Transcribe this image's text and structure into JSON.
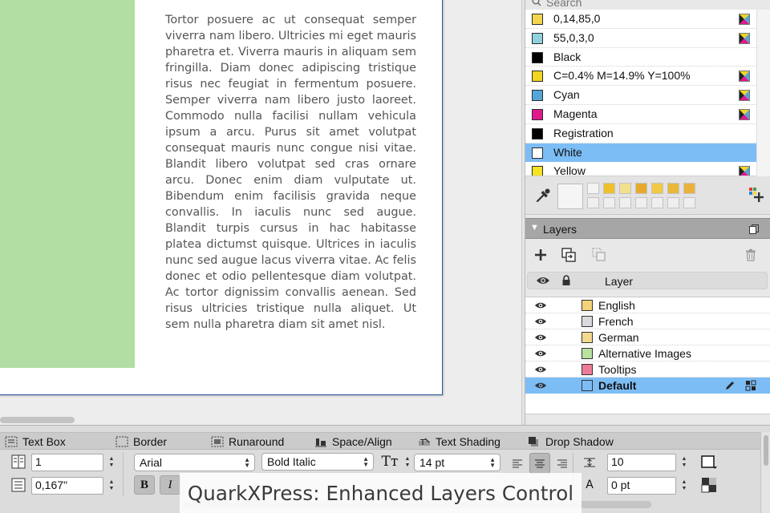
{
  "canvas": {
    "body_text": "Tortor posuere ac ut consequat semper viverra nam libero. Ultricies mi eget mauris pharetra et. Viverra mauris in aliquam sem fringilla. Diam donec adipiscing tristique risus nec feugiat in fermentum posuere. Semper viverra nam libero justo laoreet. Commodo nulla facilisi nullam vehicula ipsum a arcu. Purus sit amet volutpat consequat mauris nunc congue nisi vitae. Blandit libero volutpat sed cras ornare arcu. Donec enim diam vulputate ut. Bibendum enim facilisis gravida neque convallis. In iaculis nunc sed augue. Blandit turpis cursus in hac habitasse platea dictumst quisque. Ultrices in iaculis nunc sed augue lacus viverra vitae. Ac felis donec et odio pellentesque diam volutpat. Ac tortor dignissim convallis aenean. Sed risus ultricies tristique nulla aliquet. Ut sem nulla pharetra diam sit amet nisl."
  },
  "colors_panel": {
    "search_placeholder": "Search",
    "items": [
      {
        "name": "0,14,85,0",
        "swatch": "#f2d74e"
      },
      {
        "name": "55,0,3,0",
        "swatch": "#8fd1dd"
      },
      {
        "name": "Black",
        "swatch": "#000000"
      },
      {
        "name": "C=0.4% M=14.9% Y=100%",
        "swatch": "#f0d521"
      },
      {
        "name": "Cyan",
        "swatch": "#55a6d8"
      },
      {
        "name": "Magenta",
        "swatch": "#e0188c"
      },
      {
        "name": "Registration",
        "swatch": "#000000"
      },
      {
        "name": "White",
        "swatch": "#ffffff"
      },
      {
        "name": "Yellow",
        "swatch": "#f5e324"
      }
    ],
    "selected_index": 7,
    "recent_colors": [
      "#f4f4f4",
      "#f0c02c",
      "#f2e08c",
      "#e8a92b",
      "#f2c844",
      "#eab838",
      "#ebb23a"
    ]
  },
  "layers_panel": {
    "title": "Layers",
    "column_label": "Layer",
    "items": [
      {
        "name": "English",
        "swatch": "#f3d27a"
      },
      {
        "name": "French",
        "swatch": "#d9d9de"
      },
      {
        "name": "German",
        "swatch": "#f2d98e"
      },
      {
        "name": "Alternative Images",
        "swatch": "#b7e29f"
      },
      {
        "name": "Tooltips",
        "swatch": "#ee7c98"
      },
      {
        "name": "Default",
        "swatch": "#7dbdf5"
      }
    ],
    "selected_index": 5
  },
  "measurements": {
    "tabs": [
      "Text Box",
      "Border",
      "Runaround",
      "Space/Align",
      "Text Shading",
      "Drop Shadow"
    ],
    "columns_value": "1",
    "gutter_value": "0,167\"",
    "font_family": "Arial",
    "font_style": "Bold Italic",
    "font_size": "14 pt",
    "leading_value": "10",
    "tracking_value": "0 pt",
    "bold_label": "B",
    "italic_label": "I"
  },
  "caption": "QuarkXPress: Enhanced Layers Control"
}
